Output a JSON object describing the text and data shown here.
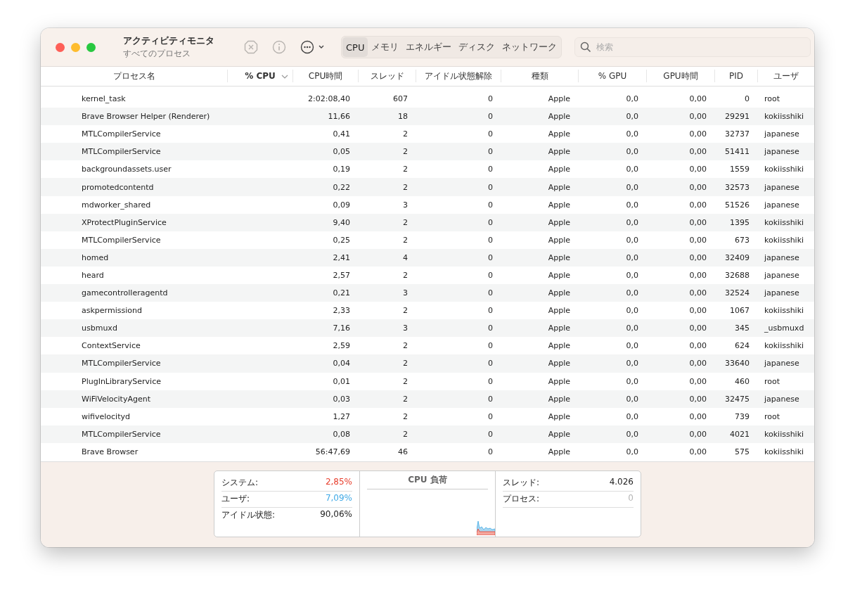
{
  "window": {
    "title": "アクティビティモニタ",
    "subtitle": "すべてのプロセス"
  },
  "tabs": [
    {
      "label": "CPU",
      "selected": true
    },
    {
      "label": "メモリ",
      "selected": false
    },
    {
      "label": "エネルギー",
      "selected": false
    },
    {
      "label": "ディスク",
      "selected": false
    },
    {
      "label": "ネットワーク",
      "selected": false
    }
  ],
  "search": {
    "placeholder": "検索"
  },
  "table": {
    "columns": [
      {
        "label": "プロセス名",
        "sorted": false
      },
      {
        "label": "% CPU",
        "sorted": true
      },
      {
        "label": "CPU時間",
        "sorted": false
      },
      {
        "label": "スレッド",
        "sorted": false
      },
      {
        "label": "アイドル状態解除",
        "sorted": false
      },
      {
        "label": "種類",
        "sorted": false
      },
      {
        "label": "% GPU",
        "sorted": false
      },
      {
        "label": "GPU時間",
        "sorted": false
      },
      {
        "label": "PID",
        "sorted": false
      },
      {
        "label": "ユーザ",
        "sorted": false
      }
    ],
    "rows": [
      [
        "kernel_task",
        "",
        "2:02:08,40",
        "607",
        "0",
        "Apple",
        "0,0",
        "0,00",
        "0",
        "root"
      ],
      [
        "Brave Browser Helper (Renderer)",
        "",
        "11,66",
        "18",
        "0",
        "Apple",
        "0,0",
        "0,00",
        "29291",
        "kokiisshiki"
      ],
      [
        "MTLCompilerService",
        "",
        "0,41",
        "2",
        "0",
        "Apple",
        "0,0",
        "0,00",
        "32737",
        "japanese"
      ],
      [
        "MTLCompilerService",
        "",
        "0,05",
        "2",
        "0",
        "Apple",
        "0,0",
        "0,00",
        "51411",
        "japanese"
      ],
      [
        "backgroundassets.user",
        "",
        "0,19",
        "2",
        "0",
        "Apple",
        "0,0",
        "0,00",
        "1559",
        "kokiisshiki"
      ],
      [
        "promotedcontentd",
        "",
        "0,22",
        "2",
        "0",
        "Apple",
        "0,0",
        "0,00",
        "32573",
        "japanese"
      ],
      [
        "mdworker_shared",
        "",
        "0,09",
        "3",
        "0",
        "Apple",
        "0,0",
        "0,00",
        "51526",
        "japanese"
      ],
      [
        "XProtectPluginService",
        "",
        "9,40",
        "2",
        "0",
        "Apple",
        "0,0",
        "0,00",
        "1395",
        "kokiisshiki"
      ],
      [
        "MTLCompilerService",
        "",
        "0,25",
        "2",
        "0",
        "Apple",
        "0,0",
        "0,00",
        "673",
        "kokiisshiki"
      ],
      [
        "homed",
        "",
        "2,41",
        "4",
        "0",
        "Apple",
        "0,0",
        "0,00",
        "32409",
        "japanese"
      ],
      [
        "heard",
        "",
        "2,57",
        "2",
        "0",
        "Apple",
        "0,0",
        "0,00",
        "32688",
        "japanese"
      ],
      [
        "gamecontrolleragentd",
        "",
        "0,21",
        "3",
        "0",
        "Apple",
        "0,0",
        "0,00",
        "32524",
        "japanese"
      ],
      [
        "askpermissiond",
        "",
        "2,33",
        "2",
        "0",
        "Apple",
        "0,0",
        "0,00",
        "1067",
        "kokiisshiki"
      ],
      [
        "usbmuxd",
        "",
        "7,16",
        "3",
        "0",
        "Apple",
        "0,0",
        "0,00",
        "345",
        "_usbmuxd"
      ],
      [
        "ContextService",
        "",
        "2,59",
        "2",
        "0",
        "Apple",
        "0,0",
        "0,00",
        "624",
        "kokiisshiki"
      ],
      [
        "MTLCompilerService",
        "",
        "0,04",
        "2",
        "0",
        "Apple",
        "0,0",
        "0,00",
        "33640",
        "japanese"
      ],
      [
        "PlugInLibraryService",
        "",
        "0,01",
        "2",
        "0",
        "Apple",
        "0,0",
        "0,00",
        "460",
        "root"
      ],
      [
        "WiFiVelocityAgent",
        "",
        "0,03",
        "2",
        "0",
        "Apple",
        "0,0",
        "0,00",
        "32475",
        "japanese"
      ],
      [
        "wifivelocityd",
        "",
        "1,27",
        "2",
        "0",
        "Apple",
        "0,0",
        "0,00",
        "739",
        "root"
      ],
      [
        "MTLCompilerService",
        "",
        "0,08",
        "2",
        "0",
        "Apple",
        "0,0",
        "0,00",
        "4021",
        "kokiisshiki"
      ],
      [
        "Brave Browser",
        "",
        "56:47,69",
        "46",
        "0",
        "Apple",
        "0,0",
        "0,00",
        "575",
        "kokiisshiki"
      ]
    ]
  },
  "summary": {
    "left": [
      {
        "label": "システム:",
        "value": "2,85%",
        "color": "#e8402f"
      },
      {
        "label": "ユーザ:",
        "value": "7,09%",
        "color": "#3fa9e6"
      },
      {
        "label": "アイドル状態:",
        "value": "90,06%",
        "color": "#222222"
      }
    ],
    "chart_title": "CPU 負荷",
    "right": [
      {
        "label": "スレッド:",
        "value": "4.026",
        "color": "#222222"
      },
      {
        "label": "プロセス:",
        "value": "0",
        "color": "#b5b5b5"
      }
    ]
  }
}
